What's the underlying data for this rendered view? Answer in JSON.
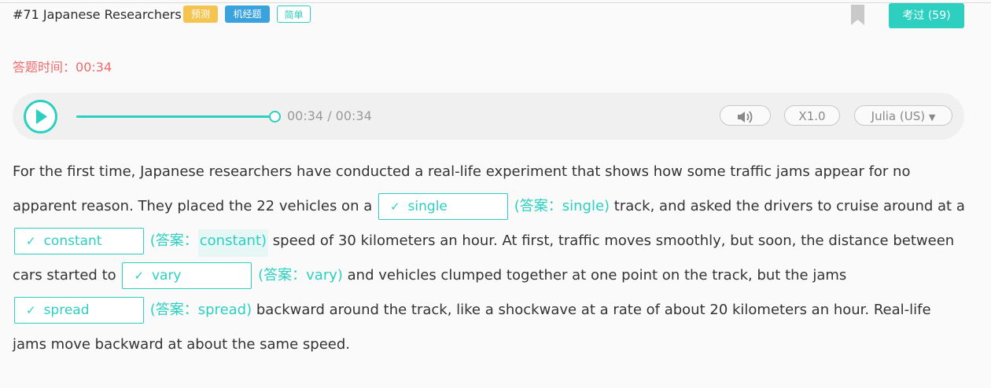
{
  "header": {
    "title": "#71 Japanese Researchers",
    "tags": [
      "预测",
      "机经题",
      "简单"
    ],
    "exam_button": "考过 (59)"
  },
  "timer": {
    "label": "答题时间：",
    "value": "00:34"
  },
  "player": {
    "time": "00:34 / 00:34",
    "progress": 1.0,
    "speed": "X1.0",
    "voice": "Julia (US)"
  },
  "passage": {
    "s1": "For the first time, Japanese researchers have conducted a real-life experiment that shows how some traffic jams appear for no apparent reason. They placed the 22 vehicles on a",
    "b1": "single",
    "a1": "(答案：single)",
    "s2": "track, and asked the drivers to cruise around at a",
    "b2": "constant",
    "a2_prefix": "(答案：",
    "a2_word": "constant)",
    "s3": "speed of 30 kilometers an hour. At first, traffic moves smoothly, but soon, the distance between cars started to",
    "b3": "vary",
    "a3": "(答案：vary)",
    "s4": "and vehicles clumped together at one point on the track, but the jams",
    "b4": "spread",
    "a4": "(答案：spread)",
    "s5": "backward around the track, like a shockwave at a rate of about 20 kilometers an hour. Real-life jams move backward at about the same speed."
  },
  "colors": {
    "accent": "#2dcfc1",
    "timer_red": "#f06b6b",
    "tag_yellow": "#f5c34f",
    "tag_blue": "#3aa3de"
  }
}
